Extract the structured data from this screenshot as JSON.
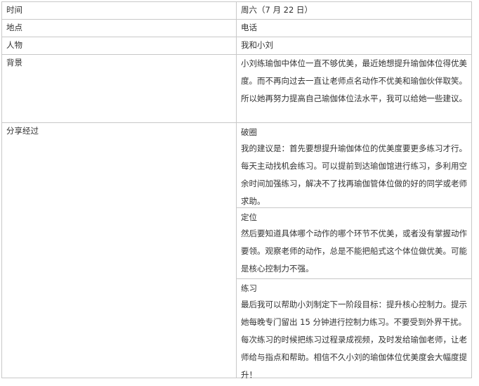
{
  "rows": {
    "time": {
      "label": "时间",
      "value": "周六（7 月 22 日）"
    },
    "place": {
      "label": "地点",
      "value": "电话"
    },
    "people": {
      "label": "人物",
      "value": "我和小刘"
    },
    "background": {
      "label": "背景",
      "value": "小刘练瑜伽中体位一直不够优美，最近她想提升瑜伽体位得优美度。而不再向过去一直让老师点名动作不优美和瑜伽伙伴取笑。所以她再努力提高自己瑜伽体位法水平，我可以给她一些建议。"
    },
    "process": {
      "label": "分享经过",
      "sections": [
        {
          "title": "破圈",
          "body": "我的建议是：首先要想提升瑜伽体位的优美度要更多练习才行。每天主动找机会练习。可以提前到达瑜伽馆进行练习，多利用空余时间加强练习，解决不了找再瑜伽管体位做的好的同学或老师求助。"
        },
        {
          "title": "定位",
          "body": "然后要知道具体哪个动作的哪个环节不优美，或者没有掌握动作要领。观察老师的动作，总是不能把船式这个体位做优美。可能是核心控制力不强。"
        },
        {
          "title": "练习",
          "body": "最后我可以帮助小刘制定下一阶段目标：提升核心控制力。提示她每晚专门留出 15 分钟进行控制力练习。不要受到外界干扰。每次练习的时候把练习过程录成视频，及时发给瑜伽老师，让老师给与指点和帮助。相信不久小刘的瑜伽体位优美度会大幅度提升！"
        }
      ]
    }
  }
}
